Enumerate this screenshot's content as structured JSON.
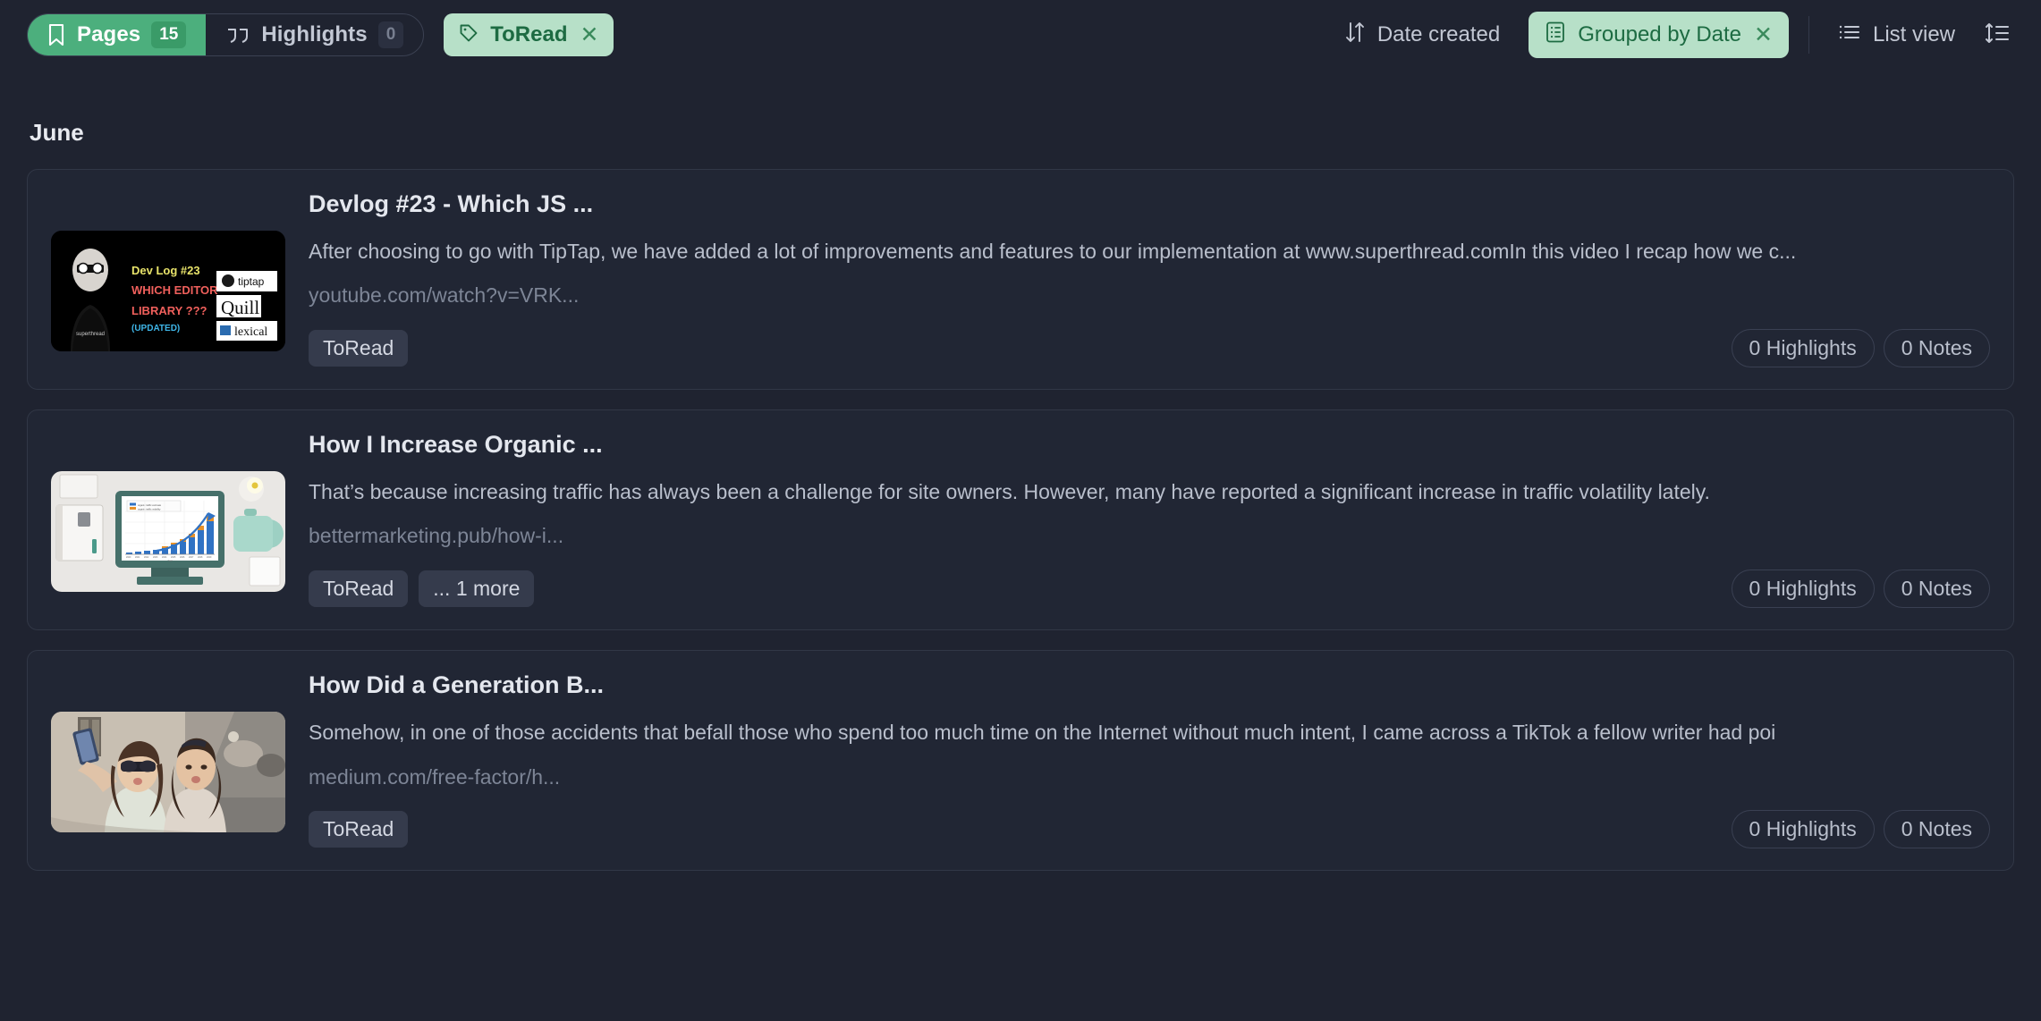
{
  "toolbar": {
    "segments": [
      {
        "label": "Pages",
        "count": "15",
        "icon": "bookmark-icon",
        "active": true
      },
      {
        "label": "Highlights",
        "count": "0",
        "icon": "quote-icon",
        "active": false
      }
    ],
    "filter_chip": {
      "label": "ToRead",
      "icon": "tag-icon",
      "close": "✕"
    },
    "sort": {
      "label": "Date created",
      "icon": "sort-arrows-icon"
    },
    "group_chip": {
      "label": "Grouped by Date",
      "icon": "list-document-icon",
      "close": "✕"
    },
    "view": {
      "label": "List view",
      "icon": "list-view-icon"
    },
    "density_icon": "sort-density-icon"
  },
  "colors": {
    "accent_green": "#4caf7d",
    "chip_green_bg": "#b7e0c8",
    "chip_green_text": "#1d6b42",
    "page_bg": "#1f2330",
    "card_bg": "#212634"
  },
  "groups": [
    {
      "title": "June",
      "cards": [
        {
          "title": "Devlog #23 - Which JS ...",
          "description": "After choosing to go with TipTap, we have added a lot of improvements and features to our implementation at www.superthread.comIn this video I recap how we c...",
          "url": "youtube.com/watch?v=VRK...",
          "thumbnail": "devlog-youtube-thumbnail",
          "tags": [
            "ToRead"
          ],
          "highlights": "0 Highlights",
          "notes": "0 Notes"
        },
        {
          "title": "How I Increase Organic ...",
          "description": "That’s because increasing traffic has always been a challenge for site owners. However, many have reported a significant increase in traffic volatility lately.",
          "url": "bettermarketing.pub/how-i...",
          "thumbnail": "traffic-chart-monitor-thumbnail",
          "tags": [
            "ToRead",
            "... 1 more"
          ],
          "highlights": "0 Highlights",
          "notes": "0 Notes"
        },
        {
          "title": "How Did a Generation B...",
          "description": "Somehow, in one of those accidents that befall those who spend too much time on the Internet without much intent, I came across a TikTok a fellow writer had poi",
          "url": "medium.com/free-factor/h...",
          "thumbnail": "selfie-women-thumbnail",
          "tags": [
            "ToRead"
          ],
          "highlights": "0 Highlights",
          "notes": "0 Notes"
        }
      ]
    }
  ]
}
